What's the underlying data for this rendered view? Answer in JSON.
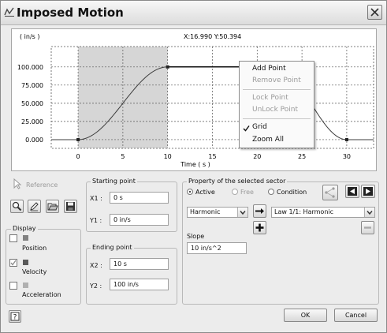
{
  "window": {
    "title": "Imposed Motion",
    "close_icon": "close-icon"
  },
  "plot": {
    "y_unit": "( in/s )",
    "coords": "X:16.990 Y:50.394",
    "x_label": "Time ( s )",
    "y_ticks": [
      "100.000",
      "75.000",
      "50.000",
      "25.000",
      "0.000"
    ],
    "x_ticks": [
      "0",
      "5",
      "10",
      "15",
      "20",
      "25",
      "30"
    ],
    "grid": true,
    "x_range": [
      -3,
      33
    ],
    "y_range": [
      -12,
      128
    ],
    "selected_sector": [
      0,
      10
    ],
    "curve": {
      "law": "harmonic",
      "x_start": 0,
      "x_end": 10,
      "y_start": 0,
      "y_end": 100
    },
    "flat_level": 100,
    "flat_range": [
      10,
      22
    ],
    "decline": {
      "x_start": 22,
      "x_end": 30,
      "y_start": 100,
      "y_end": 0
    },
    "tail": {
      "x_start": 30,
      "x_end": 33,
      "y": 0
    },
    "points": [
      {
        "x": 0,
        "y": 0
      },
      {
        "x": 10,
        "y": 100
      },
      {
        "x": 22,
        "y": 100
      },
      {
        "x": 30,
        "y": 0
      }
    ]
  },
  "context_menu": {
    "items": [
      {
        "label": "Add Point",
        "enabled": true
      },
      {
        "label": "Remove Point",
        "enabled": false
      },
      {
        "label": "Lock Point",
        "enabled": false
      },
      {
        "label": "UnLock Point",
        "enabled": false
      },
      {
        "label": "Grid",
        "checked": true,
        "enabled": true
      },
      {
        "label": "Zoom All",
        "enabled": true
      }
    ]
  },
  "left_panel": {
    "reference_label": "Reference",
    "toolbar_icons": [
      "zoom-icon",
      "edit-icon",
      "open-folder-icon",
      "save-icon"
    ],
    "display": {
      "title": "Display",
      "items": [
        {
          "label": "Position",
          "checked": false,
          "color": "#808080"
        },
        {
          "label": "Velocity",
          "checked": true,
          "color": "#5a5a5a"
        },
        {
          "label": "Acceleration",
          "checked": false,
          "color": "#b0b0b0"
        }
      ]
    }
  },
  "starting_point": {
    "title": "Starting point",
    "x1_label": "X1 :",
    "x1_value": "0 s",
    "y1_label": "Y1 :",
    "y1_value": "0 in/s"
  },
  "ending_point": {
    "title": "Ending point",
    "x2_label": "X2 :",
    "x2_value": "10 s",
    "y2_label": "Y2 :",
    "y2_value": "100 in/s"
  },
  "sector": {
    "title": "Property of the selected sector",
    "radio_active": "Active",
    "radio_free": "Free",
    "radio_condition": "Condition",
    "selected_radio": "Active",
    "law_type": "Harmonic",
    "law_name": "Law 1/1: Harmonic",
    "slope_label": "Slope",
    "slope_value": "10 in/s^2"
  },
  "footer": {
    "ok_label": "OK",
    "cancel_label": "Cancel"
  },
  "colors": {
    "selected_sector_fill": "#d6d6d6",
    "curve": "#3c3c3c",
    "grid": "#555555"
  }
}
